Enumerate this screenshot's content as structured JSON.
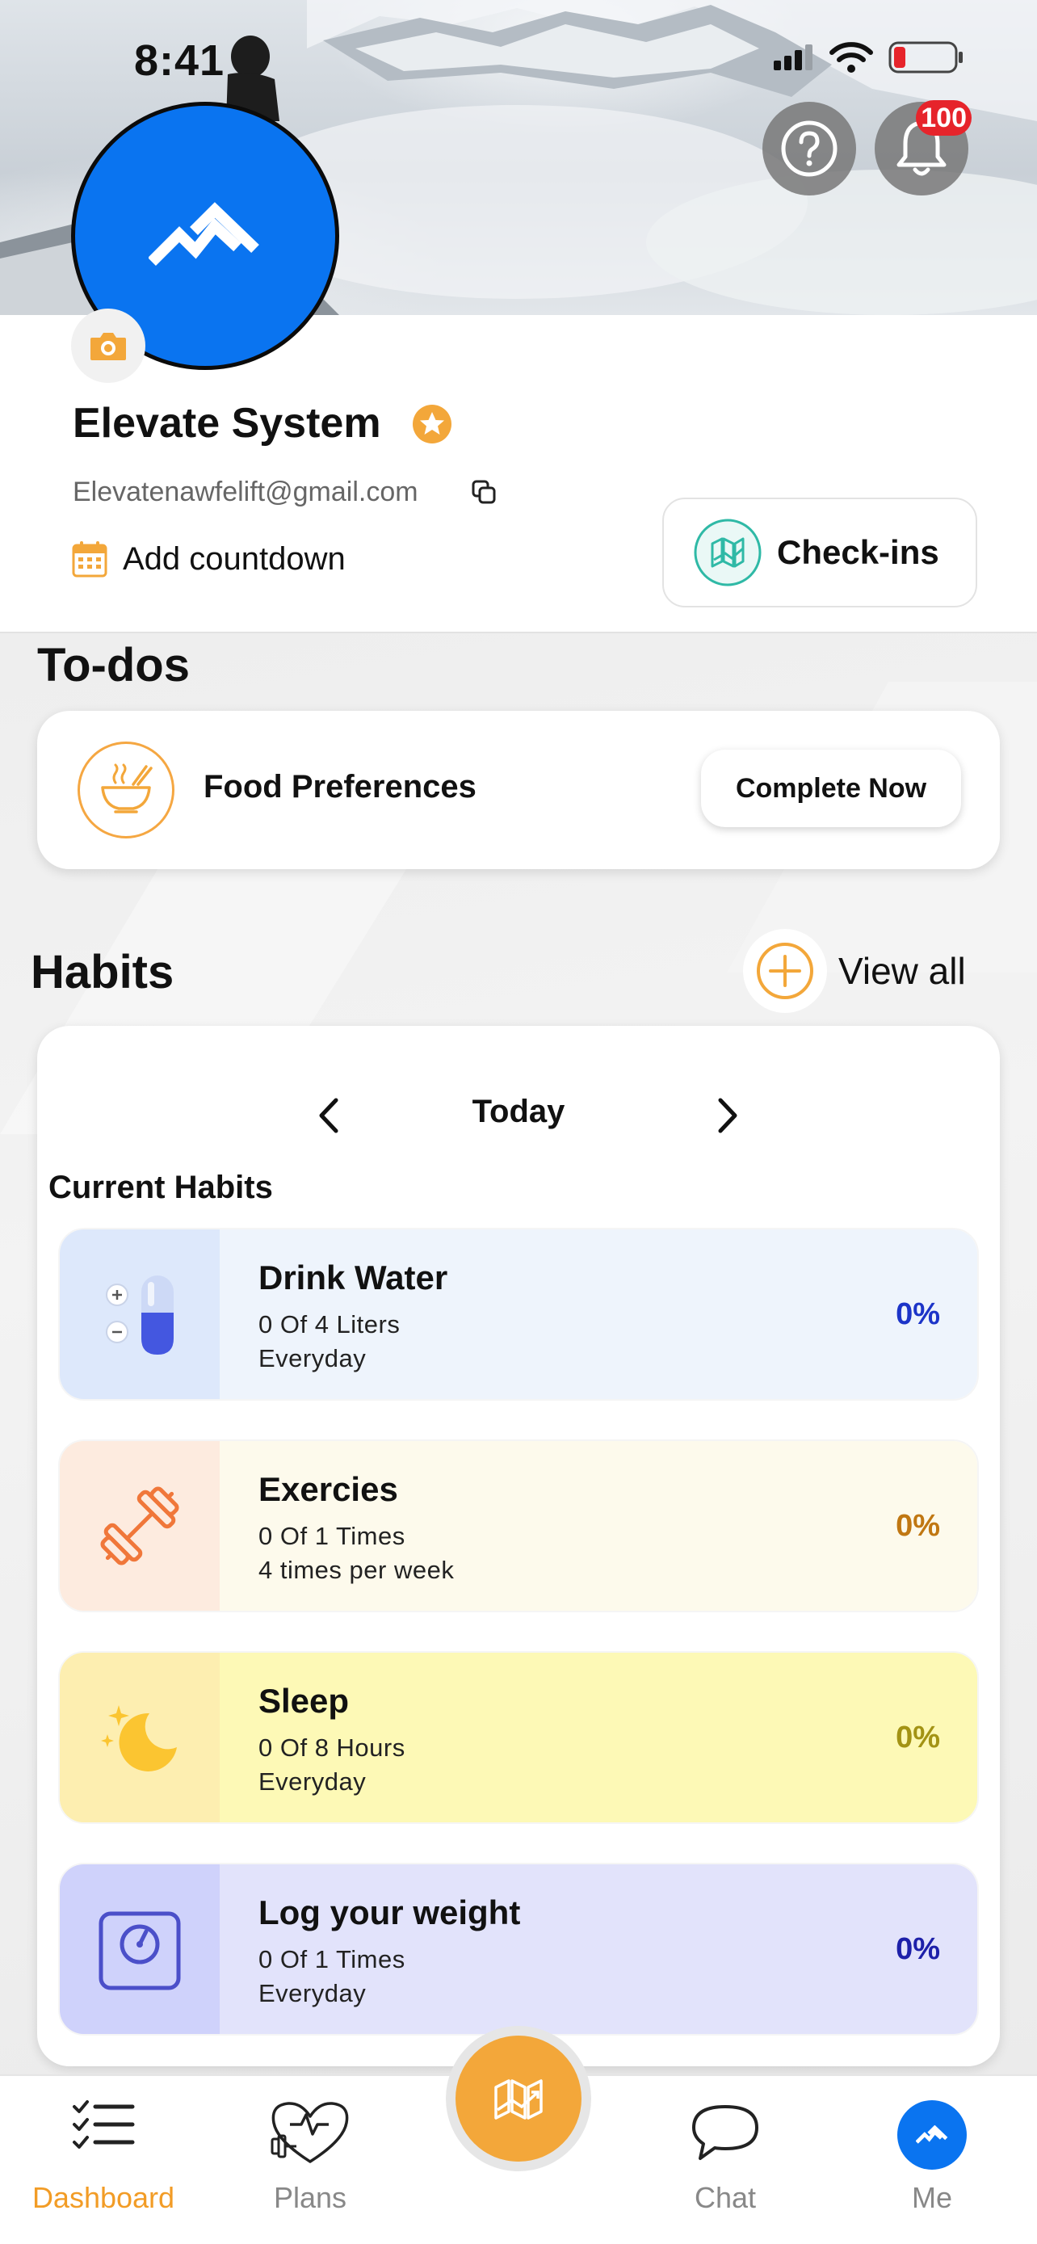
{
  "status_bar": {
    "time": "8:41"
  },
  "header": {
    "notification_count": "100"
  },
  "profile": {
    "name": "Elevate System",
    "email": "Elevatenawfelift@gmail.com",
    "countdown_label": "Add countdown",
    "checkins_label": "Check-ins"
  },
  "todos": {
    "title": "To-dos",
    "items": [
      {
        "label": "Food Preferences",
        "action": "Complete Now"
      }
    ]
  },
  "habits": {
    "title": "Habits",
    "view_all": "View all",
    "day_label": "Today",
    "current_label": "Current Habits",
    "items": [
      {
        "name": "Drink Water",
        "amount": "0 Of 4 Liters",
        "frequency": "Everyday",
        "percent": "0%",
        "icon": "water-bottle-icon",
        "bg": "#eef4fc",
        "icon_bg": "#dde8fb",
        "pct_color": "#1c34c8",
        "progress": 0
      },
      {
        "name": "Exercies",
        "amount": "0 Of 1 Times",
        "frequency": "4 times per week",
        "percent": "0%",
        "icon": "dumbbell-icon",
        "bg": "#fdfaec",
        "icon_bg": "#fdebdf",
        "pct_color": "#c07712",
        "progress": 0
      },
      {
        "name": "Sleep",
        "amount": "0 Of 8 Hours",
        "frequency": "Everyday",
        "percent": "0%",
        "icon": "moon-icon",
        "bg": "#fdf9b6",
        "icon_bg": "#fdeeb0",
        "pct_color": "#a39314",
        "progress": 0
      },
      {
        "name": "Log your weight",
        "amount": "0 Of 1 Times",
        "frequency": "Everyday",
        "percent": "0%",
        "icon": "scale-icon",
        "bg": "#e2e3fb",
        "icon_bg": "#cfd2fb",
        "pct_color": "#1d20a9",
        "progress": 0
      }
    ]
  },
  "tabbar": {
    "tabs": [
      {
        "label": "Dashboard",
        "icon": "checklist-icon",
        "active": true
      },
      {
        "label": "Plans",
        "icon": "heart-dumbbell-icon",
        "active": false
      },
      {
        "label": "Chat",
        "icon": "chat-bubble-icon",
        "active": false
      },
      {
        "label": "Me",
        "icon": "avatar-icon",
        "active": false
      }
    ],
    "center_icon": "checkins-icon"
  },
  "colors": {
    "accent": "#f3a73a",
    "brand_blue": "#0a74f0",
    "checkins_teal": "#2fb9a6",
    "badge_red": "#e6242b",
    "tab_active": "#f29c26",
    "tab_inactive": "#888888"
  }
}
